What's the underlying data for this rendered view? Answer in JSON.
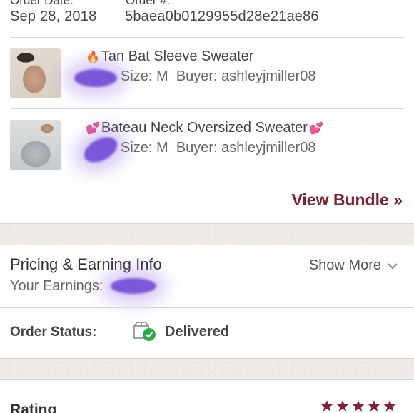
{
  "order_header": {
    "date_label": "Order Date:",
    "date_value": "Sep 28, 2018",
    "order_label": "Order #:",
    "order_value": "5baea0b0129955d28e21ae86"
  },
  "items": [
    {
      "emoji": "🔥",
      "title": "Tan Bat Sleeve Sweater",
      "emoji_after": "",
      "size_text": "Size: M",
      "buyer_text": "Buyer: ashleyjmiller08"
    },
    {
      "emoji": "💕",
      "title": "Bateau Neck Oversized Sweater",
      "emoji_after": "💕",
      "size_text": "Size: M",
      "buyer_text": "Buyer: ashleyjmiller08"
    }
  ],
  "view_bundle": "View Bundle »",
  "pricing": {
    "title": "Pricing & Earning Info",
    "earnings_label": "Your Earnings:",
    "show_more": "Show More"
  },
  "order_status": {
    "label": "Order Status:",
    "value": "Delivered",
    "icon": "delivered-box-icon"
  },
  "rating": {
    "label": "Rating",
    "stars": 5
  },
  "colors": {
    "accent": "#7d2333",
    "section_gap": "#efeae5",
    "check_green": "#2eaa4a",
    "redaction": "#7d57d9"
  }
}
